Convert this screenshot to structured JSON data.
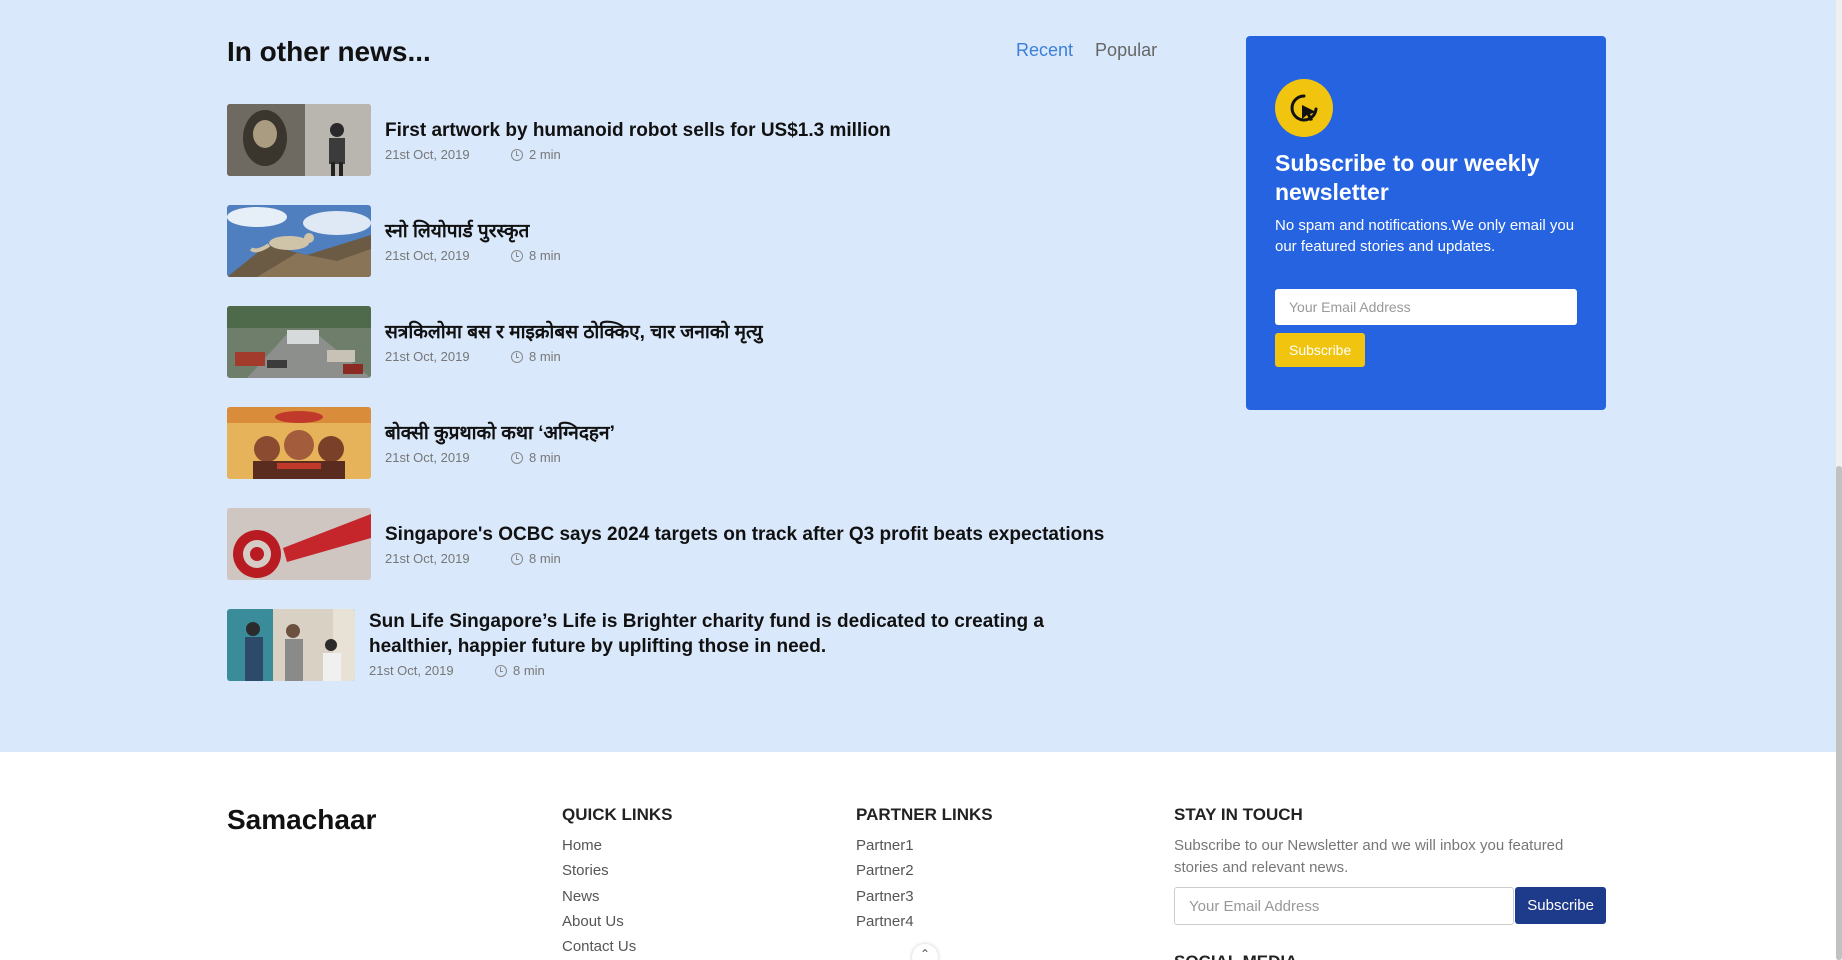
{
  "news": {
    "title": "In other news...",
    "tabs": [
      {
        "label": "Recent",
        "active": true
      },
      {
        "label": "Popular",
        "active": false
      }
    ],
    "items": [
      {
        "title": "First artwork by humanoid robot sells for US$1.3 million",
        "date": "21st Oct, 2019",
        "read_time": "2 min",
        "image": "robot-artwork-image"
      },
      {
        "title": "स्नो लियोपार्ड पुरस्कृत",
        "date": "21st Oct, 2019",
        "read_time": "8 min",
        "image": "snow-leopard-image"
      },
      {
        "title": "सत्रकिलोमा बस र माइक्रोबस ठोक्किए, चार जनाको मृत्यु",
        "date": "21st Oct, 2019",
        "read_time": "8 min",
        "image": "bus-accident-image"
      },
      {
        "title": "बोक्सी कुप्रथाको कथा ‘अग्निदहन’",
        "date": "21st Oct, 2019",
        "read_time": "8 min",
        "image": "film-poster-image"
      },
      {
        "title": "Singapore's OCBC says 2024 targets on track after Q3 profit beats expectations",
        "date": "21st Oct, 2019",
        "read_time": "8 min",
        "image": "ocbc-logo-image"
      },
      {
        "title": "Sun Life Singapore’s Life is Brighter charity fund is dedicated to creating a healthier, happier future by uplifting those in need.",
        "date": "21st Oct, 2019",
        "read_time": "8 min",
        "image": "charity-event-image"
      }
    ]
  },
  "newsletter": {
    "icon": "cursor-click-icon",
    "title": "Subscribe to our weekly newsletter",
    "description": "No spam and notifications.We only email you our featured stories and updates.",
    "placeholder": "Your Email Address",
    "button": "Subscribe",
    "card_color": "#2663e0",
    "accent_color": "#f1c40f"
  },
  "footer": {
    "brand": "Samachaar",
    "quick_links": {
      "title": "QUICK LINKS",
      "items": [
        "Home",
        "Stories",
        "News",
        "About Us",
        "Contact Us"
      ]
    },
    "partner_links": {
      "title": "PARTNER LINKS",
      "items": [
        "Partner1",
        "Partner2",
        "Partner3",
        "Partner4"
      ]
    },
    "stay_in_touch": {
      "title": "STAY IN TOUCH",
      "description": "Subscribe to our Newsletter and we will inbox you featured stories and relevant news.",
      "placeholder": "Your Email Address",
      "button": "Subscribe",
      "button_color": "#1e3a8a"
    },
    "social_title": "SOCIAL MEDIA"
  }
}
